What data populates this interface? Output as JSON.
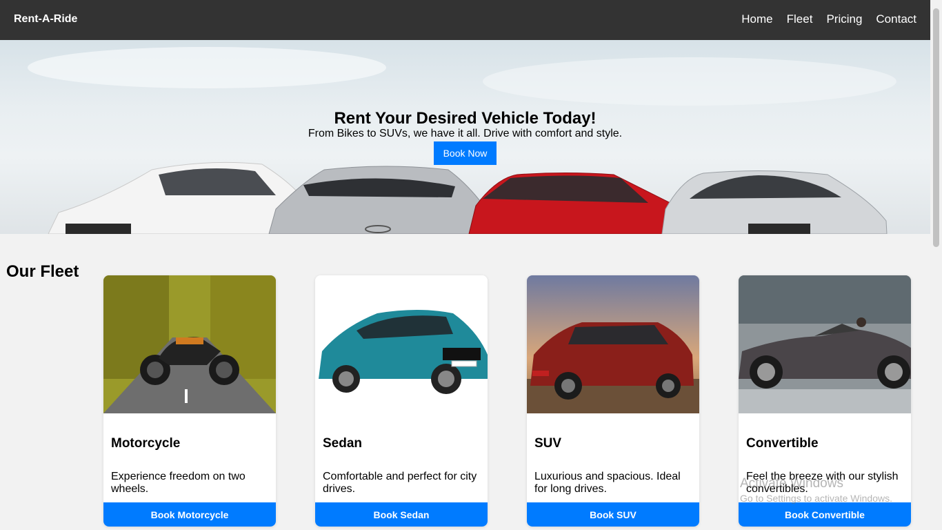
{
  "navbar": {
    "brand": "Rent-A-Ride",
    "links": [
      "Home",
      "Fleet",
      "Pricing",
      "Contact"
    ]
  },
  "hero": {
    "title": "Rent Your Desired Vehicle Today!",
    "subtitle": "From Bikes to SUVs, we have it all. Drive with comfort and style.",
    "button": "Book Now"
  },
  "fleet": {
    "title": "Our Fleet",
    "cards": [
      {
        "title": "Motorcycle",
        "description": "Experience freedom on two wheels.",
        "button": "Book Motorcycle"
      },
      {
        "title": "Sedan",
        "description": "Comfortable and perfect for city drives.",
        "button": "Book Sedan"
      },
      {
        "title": "SUV",
        "description": "Luxurious and spacious. Ideal for long drives.",
        "button": "Book SUV"
      },
      {
        "title": "Convertible",
        "description": "Feel the breeze with our stylish convertibles.",
        "button": "Book Convertible"
      }
    ]
  },
  "watermark": {
    "title": "Activate Windows",
    "subtitle": "Go to Settings to activate Windows."
  },
  "colors": {
    "accent": "#007bff",
    "navbar": "#333333",
    "page_bg": "#f2f2f2"
  }
}
